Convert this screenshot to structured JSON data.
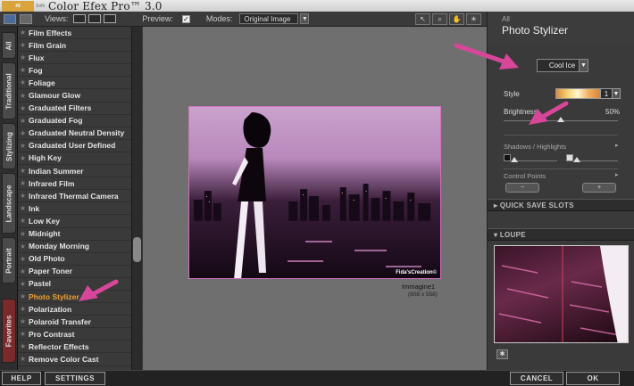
{
  "app": {
    "logo_text": "ni",
    "logo_sub": "Software",
    "title": "Color Efex Pro™ 3.0"
  },
  "toolbar": {
    "views_label": "Views:",
    "preview_label": "Preview:",
    "preview_checked_glyph": "✓",
    "modes_label": "Modes:",
    "modes_value": "Original Image",
    "tools": [
      "↖",
      "⌕",
      "✋",
      "☀"
    ]
  },
  "category_tabs": [
    {
      "label": "All"
    },
    {
      "label": "Traditional"
    },
    {
      "label": "Stylizing"
    },
    {
      "label": "Landscape"
    },
    {
      "label": "Portrait"
    },
    {
      "label": "Favorites"
    }
  ],
  "filters": [
    {
      "label": "Film Effects"
    },
    {
      "label": "Film Grain"
    },
    {
      "label": "Flux"
    },
    {
      "label": "Fog"
    },
    {
      "label": "Foliage"
    },
    {
      "label": "Glamour Glow"
    },
    {
      "label": "Graduated Filters"
    },
    {
      "label": "Graduated Fog"
    },
    {
      "label": "Graduated Neutral Density"
    },
    {
      "label": "Graduated User Defined"
    },
    {
      "label": "High Key"
    },
    {
      "label": "Indian Summer"
    },
    {
      "label": "Infrared Film"
    },
    {
      "label": "Infrared Thermal Camera"
    },
    {
      "label": "Ink"
    },
    {
      "label": "Low Key"
    },
    {
      "label": "Midnight"
    },
    {
      "label": "Monday Morning"
    },
    {
      "label": "Old Photo"
    },
    {
      "label": "Paper Toner"
    },
    {
      "label": "Pastel"
    },
    {
      "label": "Photo Stylizer"
    },
    {
      "label": "Polarization"
    },
    {
      "label": "Polaroid Transfer"
    },
    {
      "label": "Pro Contrast"
    },
    {
      "label": "Reflector Effects"
    },
    {
      "label": "Remove Color Cast"
    }
  ],
  "active_filter": "Photo Stylizer",
  "preview": {
    "image_name": "Immagine1",
    "image_size": "(808 x 558)",
    "credit": "Fida'sCreation©"
  },
  "panel": {
    "small_label": "All",
    "title": "Photo Stylizer",
    "preset_value": "Cool Ice",
    "style_label": "Style",
    "style_value": "1",
    "brightness_label": "Brightness",
    "brightness_value": "50%",
    "brightness_fraction": 0.5,
    "shadows_label": "Shadows / Highlights",
    "control_points_label": "Control Points",
    "quick_save_label": "QUICK SAVE SLOTS",
    "loupe_label": "LOUPE"
  },
  "bottom": {
    "help": "HELP",
    "settings": "SETTINGS",
    "cancel": "CANCEL",
    "ok": "OK"
  },
  "colors": {
    "accent_orange": "#f0a030",
    "annotation_pink": "#d8469a"
  }
}
